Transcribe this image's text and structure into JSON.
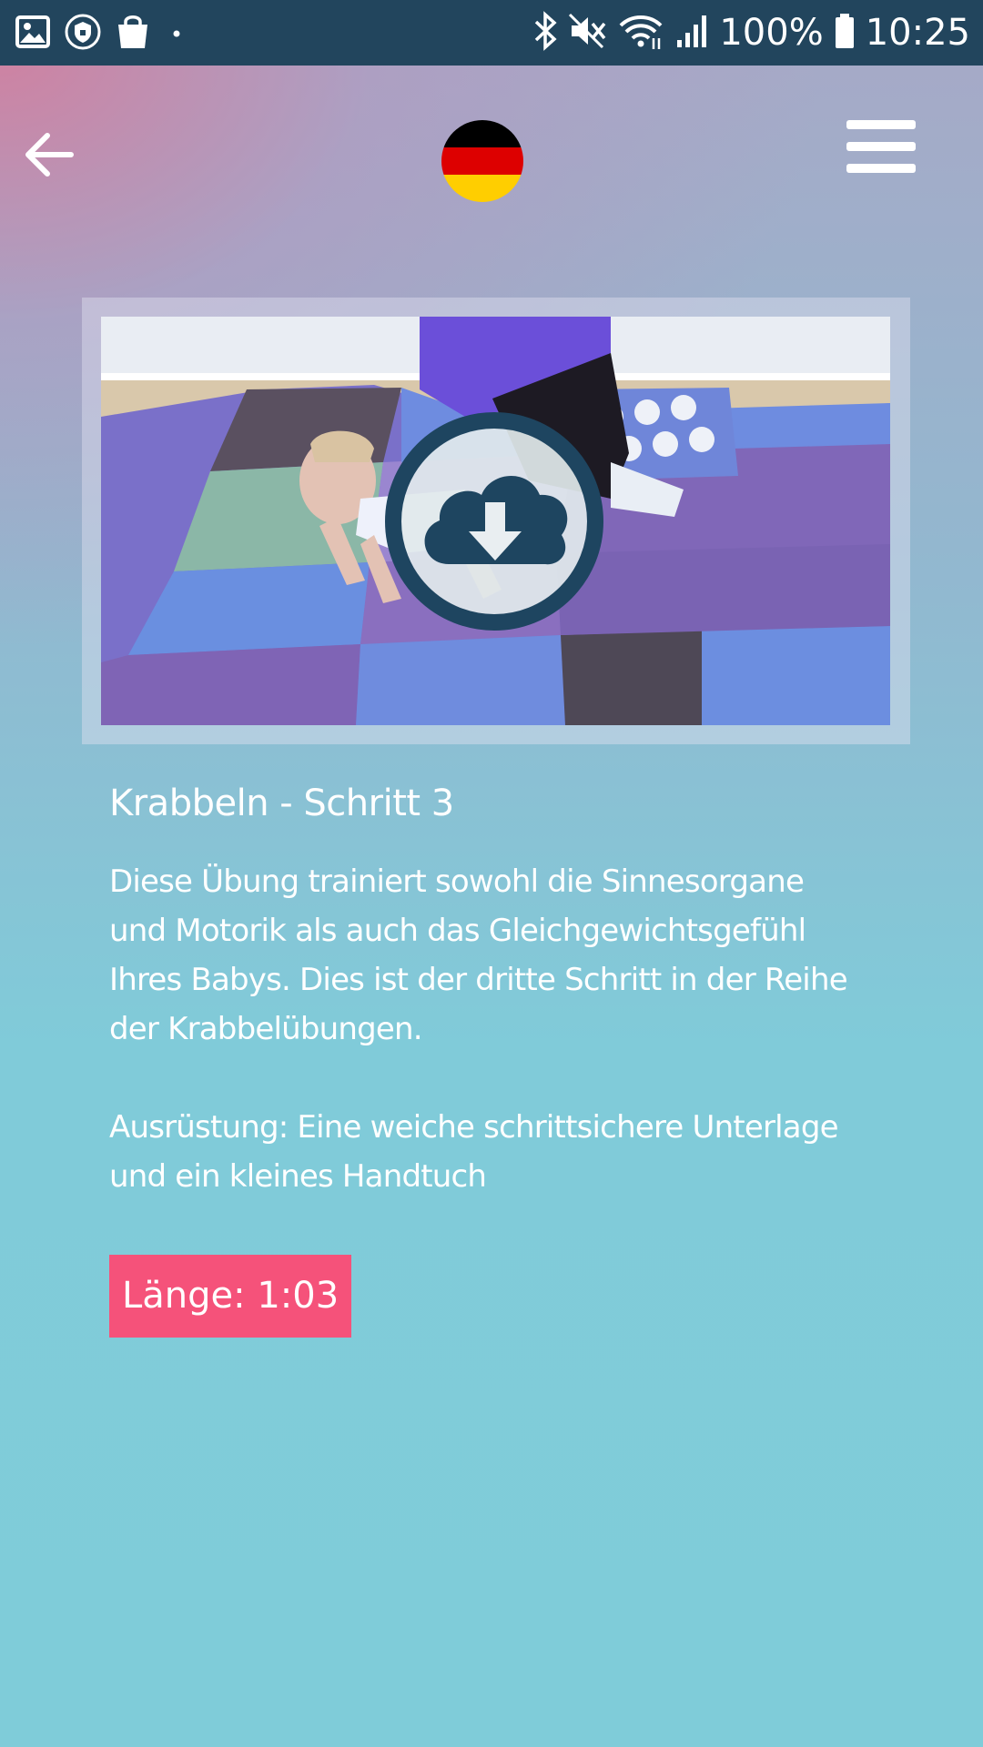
{
  "status_bar": {
    "battery": "100%",
    "time": "10:25",
    "icons": [
      "gallery-icon",
      "shield-icon",
      "shopping-bag-icon",
      "dot-icon",
      "bluetooth-icon",
      "mute-icon",
      "wifi-icon",
      "signal-icon",
      "battery-icon"
    ]
  },
  "header": {
    "back_icon": "arrow-left-icon",
    "language_flag": "germany-flag-icon",
    "menu_icon": "hamburger-menu-icon"
  },
  "video": {
    "action_icon": "cloud-download-icon",
    "colors": {
      "ring": "#1e4560",
      "frame": "#e1e1f0"
    }
  },
  "exercise": {
    "title": "Krabbeln - Schritt 3",
    "description_lines": [
      "Diese Übung trainiert sowohl die Sinnesorgane",
      "und Motorik als auch das Gleichgewichtsgefühl",
      "Ihres Babys. Dies ist der dritte Schritt in der Reihe",
      "der Krabbelübungen."
    ],
    "equipment_lines": [
      "Ausrüstung: Eine weiche schrittsichere Unterlage",
      "und ein kleines Handtuch"
    ],
    "duration": "Länge: 1:03"
  },
  "colors": {
    "status_bar": "#22455d",
    "badge": "#f5527a",
    "background_top": "#d080a0",
    "background_bottom": "#7fccd9"
  }
}
